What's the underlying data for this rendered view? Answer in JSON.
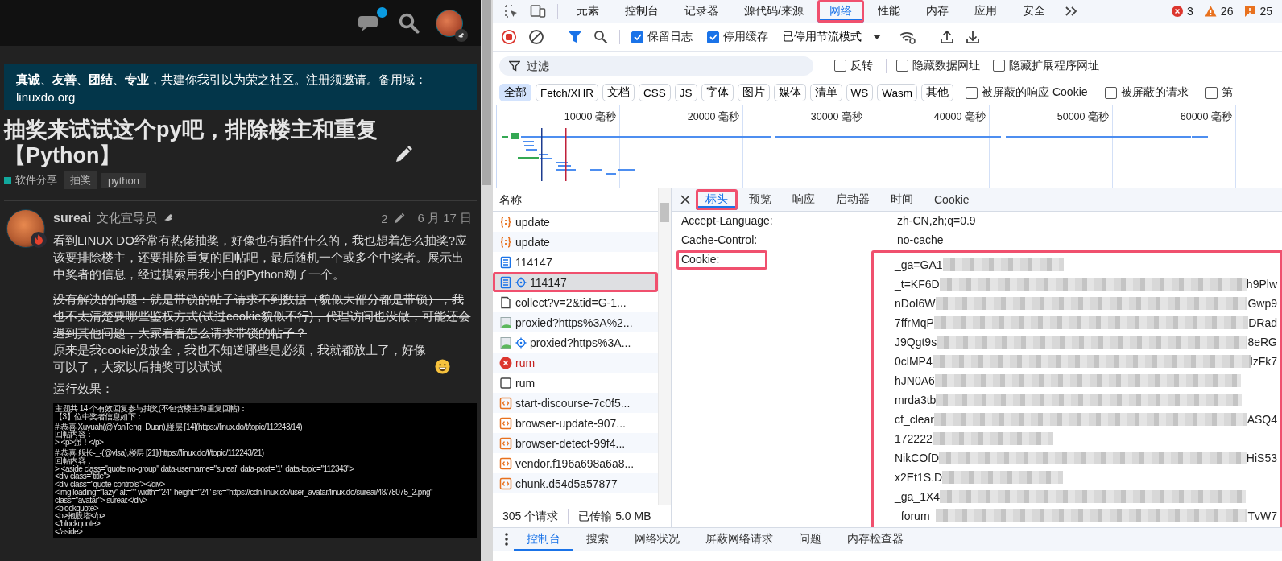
{
  "forum": {
    "header": {
      "unread": true
    },
    "banner": "**真诚**、**友善**、**团结**、**专业**，共建你我引以为荣之社区。注册须邀请。备用域：linuxdo.org",
    "topic": {
      "title": "抽奖来试试这个py吧，排除楼主和重复【Python】",
      "category": {
        "name": "软件分享",
        "color": "#12a89d"
      },
      "tags": [
        "抽奖",
        "python"
      ]
    },
    "post": {
      "username": "sureai",
      "user_title": "文化宣导员",
      "edit_count": "2",
      "date": "6 月 17 日",
      "paragraphs": [
        {
          "kind": "normal",
          "text": "看到LINUX DO经常有热佬抽奖，好像也有插件什么的，我也想着怎么抽奖?应该要排除楼主，还要排除重复的回帖吧，最后随机一个或多个中奖者。展示出中奖者的信息，经过摸索用我小白的Python糊了一个。",
          "emoji": false
        },
        {
          "kind": "struck",
          "text": "没有解决的问题：就是带锁的帖子请求不到数据（貌似大部分都是带锁），我也不太清楚要哪些鉴权方式(试过cookie貌似不行)，代理访问也没做，可能还会遇到其他问题，大家看看怎么请求带锁的帖子？",
          "emoji": false
        },
        {
          "kind": "continued",
          "text": "原来是我cookie没放全，我也不知道哪些是必须，我就都放上了，好像可以了，大家以后抽奖可以试试",
          "emoji": true
        },
        {
          "kind": "normal",
          "text": "运行效果：",
          "emoji": false
        }
      ],
      "terminal_blocks": [
        [
          "主题共 14 个有效回复参与抽奖(不包含楼主和重复回帖)：",
          "【3】位中奖者信息如下："
        ],
        [
          "# 恭喜 Xuyuah(@YanTeng_Duan),楼层 [14](https://linux.do/t/topic/112243/14)",
          "回帖内容：",
          "> <p>强！</p>"
        ],
        [
          "# 恭喜 舰长-_-(@vlsa),楼层 [21](https://linux.do/t/topic/112243/21)",
          "回帖内容：",
          "> <aside class=\"quote no-group\" data-username=\"sureai\" data-post=\"1\" data-topic=\"112343\">",
          "<div class=\"title\">",
          "<div class=\"quote-controls\"></div>",
          "<img loading=\"lazy\" alt=\"\" width=\"24\" height=\"24\" src=\"https://cdn.linux.do/user_avatar/linux.do/sureai/48/78075_2.png\"",
          "class=\"avatar\"> sureai:</div>",
          "<blockquote>",
          "<p>抱股塔</p>",
          "</blockquote>",
          "</aside>"
        ]
      ]
    }
  },
  "devtools": {
    "panel_tabs": [
      {
        "label": "元素",
        "selected": false,
        "highlighted": false
      },
      {
        "label": "控制台",
        "selected": false,
        "highlighted": false
      },
      {
        "label": "记录器",
        "selected": false,
        "highlighted": false
      },
      {
        "label": "源代码/来源",
        "selected": false,
        "highlighted": false
      },
      {
        "label": "网络",
        "selected": true,
        "highlighted": true
      },
      {
        "label": "性能",
        "selected": false,
        "highlighted": false
      },
      {
        "label": "内存",
        "selected": false,
        "highlighted": false
      },
      {
        "label": "应用",
        "selected": false,
        "highlighted": false
      },
      {
        "label": "安全",
        "selected": false,
        "highlighted": false
      }
    ],
    "issues": {
      "errors": "3",
      "warnings": "26",
      "info": "25"
    },
    "toolbar": {
      "recording": true,
      "checkboxes": [
        {
          "label": "保留日志",
          "checked": true
        },
        {
          "label": "停用缓存",
          "checked": true
        }
      ],
      "throttling": "已停用节流模式"
    },
    "filter": {
      "placeholder": "过滤",
      "options": [
        {
          "label": "反转",
          "checked": false
        },
        {
          "label": "隐藏数据网址",
          "checked": false
        },
        {
          "label": "隐藏扩展程序网址",
          "checked": false
        }
      ]
    },
    "type_filters": [
      {
        "label": "全部",
        "selected": true
      },
      {
        "label": "Fetch/XHR",
        "selected": false
      },
      {
        "label": "文档",
        "selected": false
      },
      {
        "label": "CSS",
        "selected": false
      },
      {
        "label": "JS",
        "selected": false
      },
      {
        "label": "字体",
        "selected": false
      },
      {
        "label": "图片",
        "selected": false
      },
      {
        "label": "媒体",
        "selected": false
      },
      {
        "label": "清单",
        "selected": false
      },
      {
        "label": "WS",
        "selected": false
      },
      {
        "label": "Wasm",
        "selected": false
      },
      {
        "label": "其他",
        "selected": false
      }
    ],
    "type_options": [
      {
        "label": "被屏蔽的响应 Cookie",
        "checked": false
      },
      {
        "label": "被屏蔽的请求",
        "checked": false
      },
      {
        "label": "第",
        "checked": false
      }
    ],
    "timeline_ticks": [
      "10000 毫秒",
      "20000 毫秒",
      "30000 毫秒",
      "40000 毫秒",
      "50000 毫秒",
      "60000 毫秒"
    ],
    "requests": {
      "column": "名称",
      "rows": [
        {
          "name": "update",
          "kind": "json",
          "service_worker": false,
          "selected": false,
          "highlighted": false
        },
        {
          "name": "update",
          "kind": "json",
          "service_worker": false,
          "selected": false,
          "highlighted": false
        },
        {
          "name": "114147",
          "kind": "document",
          "service_worker": false,
          "selected": false,
          "highlighted": false
        },
        {
          "name": "114147",
          "kind": "document",
          "service_worker": true,
          "selected": true,
          "highlighted": true
        },
        {
          "name": "collect?v=2&tid=G-1...",
          "kind": "file",
          "service_worker": false,
          "selected": false,
          "highlighted": false
        },
        {
          "name": "proxied?https%3A%2...",
          "kind": "image",
          "service_worker": false,
          "selected": false,
          "highlighted": false
        },
        {
          "name": "proxied?https%3A...",
          "kind": "image",
          "service_worker": true,
          "selected": false,
          "highlighted": false
        },
        {
          "name": "rum",
          "kind": "error",
          "service_worker": false,
          "selected": false,
          "highlighted": false
        },
        {
          "name": "rum",
          "kind": "empty",
          "service_worker": false,
          "selected": false,
          "highlighted": false
        },
        {
          "name": "start-discourse-7c0f5...",
          "kind": "script",
          "service_worker": false,
          "selected": false,
          "highlighted": false
        },
        {
          "name": "browser-update-907...",
          "kind": "script",
          "service_worker": false,
          "selected": false,
          "highlighted": false
        },
        {
          "name": "browser-detect-99f4...",
          "kind": "script",
          "service_worker": false,
          "selected": false,
          "highlighted": false
        },
        {
          "name": "vendor.f196a698a6a8...",
          "kind": "script",
          "service_worker": false,
          "selected": false,
          "highlighted": false
        },
        {
          "name": "chunk.d54d5a57877",
          "kind": "script",
          "service_worker": false,
          "selected": false,
          "highlighted": false
        }
      ]
    },
    "summary": {
      "requests": "305 个请求",
      "transferred": "已传输 5.0 MB"
    },
    "detail": {
      "tabs": [
        {
          "label": "标头",
          "selected": true,
          "highlighted": true
        },
        {
          "label": "预览",
          "selected": false,
          "highlighted": false
        },
        {
          "label": "响应",
          "selected": false,
          "highlighted": false
        },
        {
          "label": "启动器",
          "selected": false,
          "highlighted": false
        },
        {
          "label": "时间",
          "selected": false,
          "highlighted": false
        },
        {
          "label": "Cookie",
          "selected": false,
          "highlighted": false
        }
      ],
      "headers": [
        {
          "name": "Accept-Language:",
          "value": "zh-CN,zh;q=0.9",
          "highlighted": false
        },
        {
          "name": "Cache-Control:",
          "value": "no-cache",
          "highlighted": false
        }
      ],
      "cookie": {
        "name": "Cookie:",
        "highlighted": true,
        "value_highlighted": true,
        "lines": [
          {
            "start": "_ga=GA1",
            "kind": "short"
          },
          {
            "start": "_t=KF6D",
            "kind": "long",
            "end": "h9Plw"
          },
          {
            "start": "nDoI6W",
            "kind": "long",
            "end": "Gwp9"
          },
          {
            "start": "7ffrMqP",
            "kind": "long",
            "end": "DRad"
          },
          {
            "start": "J9Qgt9s",
            "kind": "long",
            "end": "8eRG"
          },
          {
            "start": "0clMP4",
            "kind": "long",
            "end": "lzFk7"
          },
          {
            "start": "hJN0A6",
            "kind": "medium"
          },
          {
            "start": "mrda3tb",
            "kind": "medium"
          },
          {
            "start": "cf_clear",
            "kind": "long",
            "end": "ASQ4"
          },
          {
            "start": "172222",
            "kind": "short"
          },
          {
            "start": "NikCOfD",
            "kind": "long",
            "end": "HiS53"
          },
          {
            "start": "x2Et1S.D",
            "kind": "short"
          },
          {
            "start": "_ga_1X4",
            "kind": "medium"
          },
          {
            "start": "_forum_",
            "kind": "long",
            "end": "TvW7"
          }
        ]
      }
    },
    "drawer_tabs": [
      {
        "label": "控制台",
        "selected": true
      },
      {
        "label": "搜索",
        "selected": false
      },
      {
        "label": "网络状况",
        "selected": false
      },
      {
        "label": "屏蔽网络请求",
        "selected": false
      },
      {
        "label": "问题",
        "selected": false
      },
      {
        "label": "内存检查器",
        "selected": false
      }
    ]
  }
}
